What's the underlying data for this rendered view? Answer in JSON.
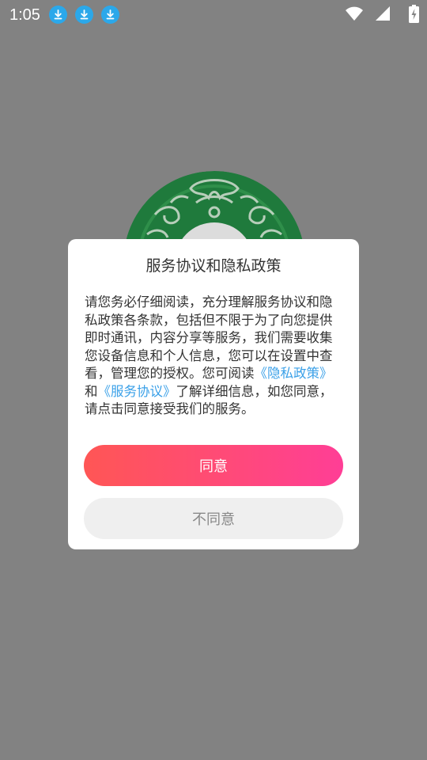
{
  "status_bar": {
    "time": "1:05",
    "icons": [
      "download-icon",
      "download-icon",
      "download-icon",
      "wifi-icon",
      "signal-icon",
      "battery-charging-icon"
    ]
  },
  "dialog": {
    "title": "服务协议和隐私政策",
    "body_text_1": "请您务必仔细阅读，充分理解服务协议和隐私政策各条款，包括但不限于为了向您提供即时通讯，内容分享等服务，我们需要收集您设备信息和个人信息，您可以在设置中查看，管理您的授权。您可阅读",
    "privacy_link": "《隐私政策》",
    "body_text_2": "和",
    "service_link": "《服务协议》",
    "body_text_3": "了解详细信息，如您同意，请点击同意接受我们的服务。",
    "agree_label": "同意",
    "disagree_label": "不同意"
  },
  "colors": {
    "overlay": "#828282",
    "link": "#3aa0e8",
    "agree_gradient_start": "#ff5655",
    "agree_gradient_end": "#ff3e96",
    "disagree_bg": "#efefef",
    "logo_green": "#1f7a3c"
  }
}
